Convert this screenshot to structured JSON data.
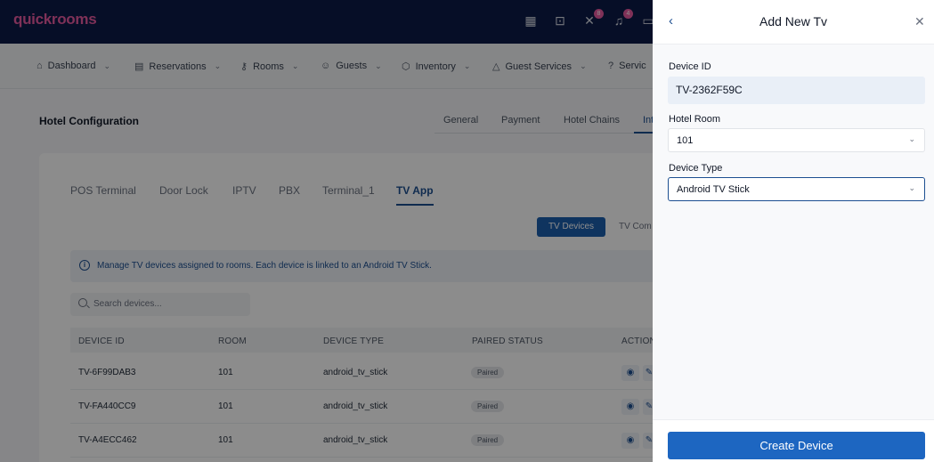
{
  "app": {
    "logo_text": "quickrooms"
  },
  "topbar": {
    "icons": [
      {
        "name": "building-icon",
        "glyph": "▦",
        "badge": ""
      },
      {
        "name": "briefcase-icon",
        "glyph": "⊡",
        "badge": ""
      },
      {
        "name": "tools-icon",
        "glyph": "✕",
        "badge": "8"
      },
      {
        "name": "bell-icon",
        "glyph": "♫",
        "badge": "4"
      },
      {
        "name": "chat-icon",
        "glyph": "▭",
        "badge": ""
      }
    ]
  },
  "nav": {
    "items": [
      {
        "label": "Dashboard",
        "icon": "home-icon",
        "glyph": "⌂"
      },
      {
        "label": "Reservations",
        "icon": "calendar-icon",
        "glyph": "▤"
      },
      {
        "label": "Rooms",
        "icon": "key-icon",
        "glyph": "⚷"
      },
      {
        "label": "Guests",
        "icon": "users-icon",
        "glyph": "☺"
      },
      {
        "label": "Inventory",
        "icon": "box-icon",
        "glyph": "⬡"
      },
      {
        "label": "Guest Services",
        "icon": "bell-service-icon",
        "glyph": "△"
      },
      {
        "label": "Servic",
        "icon": "help-icon",
        "glyph": "?"
      }
    ]
  },
  "page": {
    "title": "Hotel Configuration",
    "config_tabs": [
      "General",
      "Payment",
      "Hotel Chains",
      "Int"
    ],
    "sub_tabs": [
      "POS Terminal",
      "Door Lock",
      "IPTV",
      "PBX",
      "Terminal_1",
      "TV App"
    ],
    "segments": {
      "active": "TV Devices",
      "inactive": "TV Com"
    },
    "info_text": "Manage TV devices assigned to rooms. Each device is linked to an Android TV Stick.",
    "search_placeholder": "Search devices...",
    "table": {
      "headers": [
        "DEVICE ID",
        "ROOM",
        "DEVICE TYPE",
        "PAIRED STATUS",
        "ACTION"
      ],
      "rows": [
        {
          "device_id": "TV-6F99DAB3",
          "room": "101",
          "device_type": "android_tv_stick",
          "status": "Paired"
        },
        {
          "device_id": "TV-FA440CC9",
          "room": "101",
          "device_type": "android_tv_stick",
          "status": "Paired"
        },
        {
          "device_id": "TV-A4ECC462",
          "room": "101",
          "device_type": "android_tv_stick",
          "status": "Paired"
        }
      ]
    }
  },
  "panel": {
    "title": "Add New Tv",
    "device_id_label": "Device ID",
    "device_id_value": "TV-2362F59C",
    "hotel_room_label": "Hotel Room",
    "hotel_room_value": "101",
    "device_type_label": "Device Type",
    "device_type_value": "Android TV Stick",
    "submit_label": "Create Device"
  },
  "colors": {
    "topbar": "#0b1a47",
    "brand": "#e85aa0",
    "accent": "#1d4f91",
    "primary_button": "#1d66c1"
  }
}
